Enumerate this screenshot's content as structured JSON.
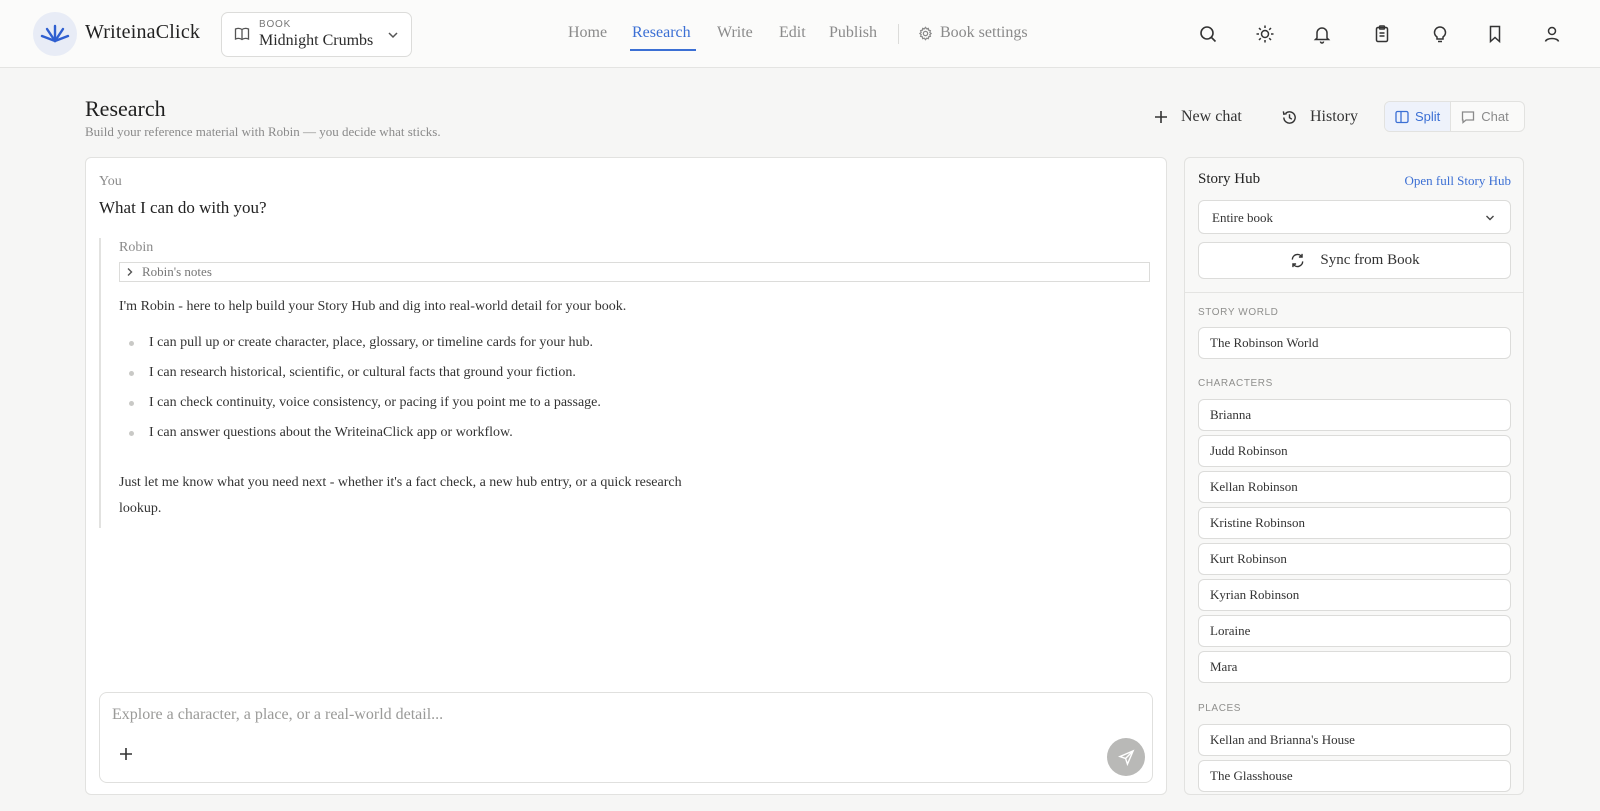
{
  "app": {
    "name": "WriteinaClick"
  },
  "book": {
    "label": "BOOK",
    "name": "Midnight Crumbs"
  },
  "nav": {
    "items": [
      {
        "label": "Home"
      },
      {
        "label": "Research"
      },
      {
        "label": "Write"
      },
      {
        "label": "Edit"
      },
      {
        "label": "Publish"
      }
    ],
    "active": "Research",
    "settings_label": "Book settings"
  },
  "icons": [
    "search-icon",
    "sun-icon",
    "bell-icon",
    "clipboard-icon",
    "lightbulb-icon",
    "bookmark-icon",
    "user-icon"
  ],
  "page": {
    "title": "Research",
    "subtitle": "Build your reference material with Robin — you decide what sticks.",
    "new_chat_label": "New chat",
    "history_label": "History",
    "view_split": "Split",
    "view_chat": "Chat"
  },
  "chat": {
    "user_label": "You",
    "user_message": "What I can do with you?",
    "assistant_label": "Robin",
    "notes_label": "Robin's notes",
    "intro": "I'm Robin - here to help build your Story Hub and dig into real-world detail for your book.",
    "bullets": [
      "I can pull up or create character, place, glossary, or timeline cards for your hub.",
      "I can research historical, scientific, or cultural facts that ground your fiction.",
      "I can check continuity, voice consistency, or pacing if you point me to a passage.",
      "I can answer questions about the WriteinaClick app or workflow."
    ],
    "outro": "Just let me know what you need next - whether it's a fact check, a new hub entry, or a quick research lookup.",
    "composer_placeholder": "Explore a character, a place, or a real-world detail..."
  },
  "hub": {
    "title": "Story Hub",
    "open_link": "Open full Story Hub",
    "scope": "Entire book",
    "sync_label": "Sync from Book",
    "sections": {
      "world": "STORY WORLD",
      "characters": "CHARACTERS",
      "places": "PLACES"
    },
    "world": [
      "The Robinson World"
    ],
    "characters": [
      "Brianna",
      "Judd Robinson",
      "Kellan Robinson",
      "Kristine Robinson",
      "Kurt Robinson",
      "Kyrian Robinson",
      "Loraine",
      "Mara"
    ],
    "places": [
      "Kellan and Brianna's House",
      "The Glasshouse"
    ]
  },
  "colors": {
    "accent": "#3b6fd4",
    "background": "#f6f6f5"
  }
}
